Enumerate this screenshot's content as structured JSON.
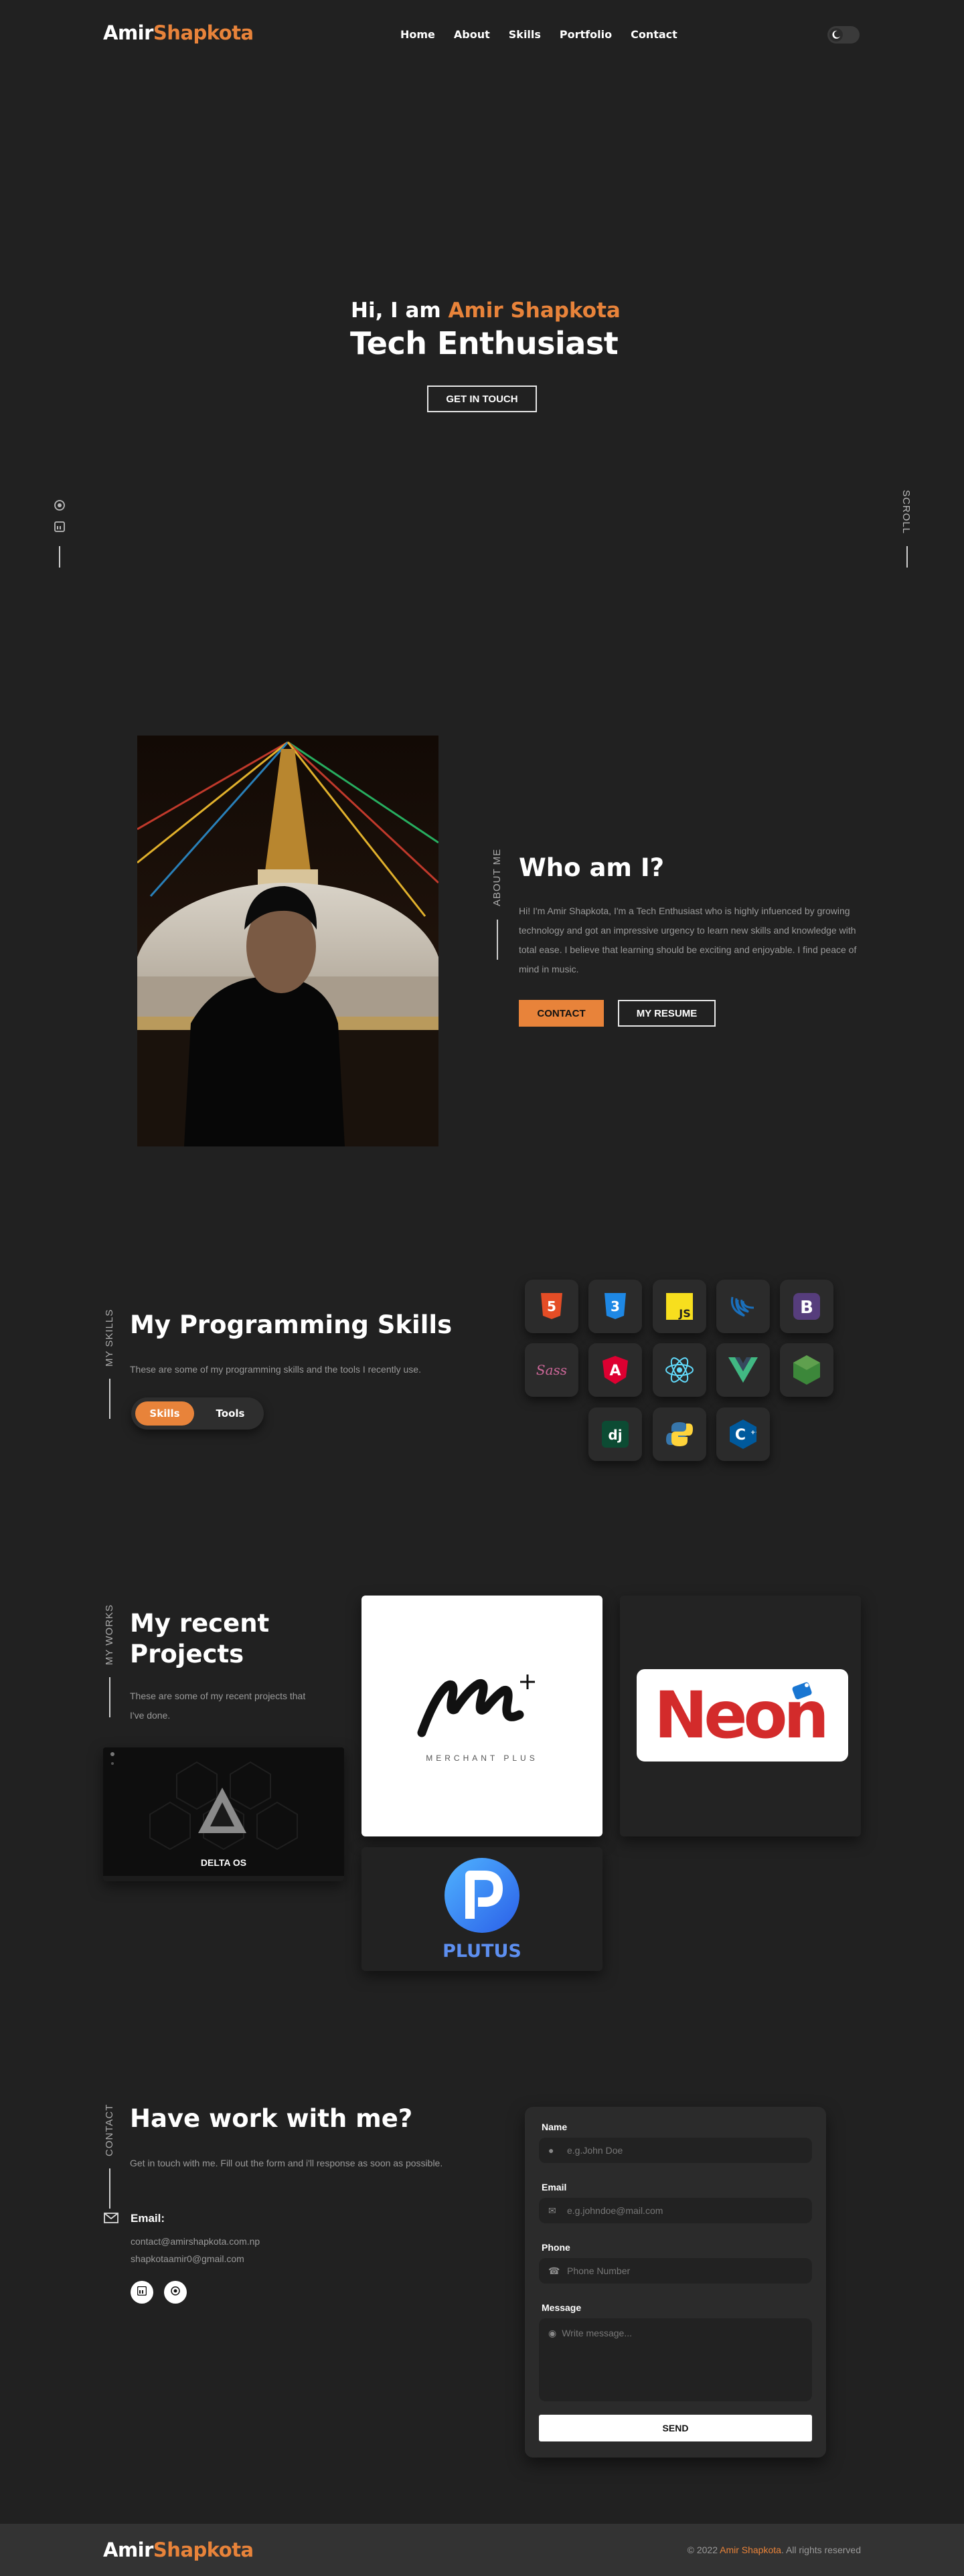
{
  "nav": {
    "logo_first": "Amir",
    "logo_second": "Shapkota",
    "links": [
      "Home",
      "About",
      "Skills",
      "Portfolio",
      "Contact"
    ],
    "theme_icon": "moon-icon"
  },
  "hero": {
    "greeting": "Hi, I am ",
    "name": "Amir Shapkota",
    "title": "Tech Enthusiast",
    "cta": "GET IN TOUCH",
    "scroll_label": "SCROLL",
    "social_icons": [
      "github-icon",
      "linkedin-icon"
    ]
  },
  "about": {
    "side_label": "ABOUT ME",
    "title": "Who am I?",
    "text": "Hi! I'm Amir Shapkota, I'm a Tech Enthusiast who is highly infuenced by growing technology and got an impressive urgency to learn new skills and knowledge with total ease. I believe that learning should be exciting and enjoyable. I find peace of mind in music.",
    "contact_btn": "CONTACT",
    "resume_btn": "MY RESUME"
  },
  "skills": {
    "side_label": "MY SKILLS",
    "title": "My Programming Skills",
    "text": "These are some of my programming skills and the tools I recently use.",
    "toggle_on": "Skills",
    "toggle_off": "Tools",
    "tiles": [
      {
        "icon": "html5-icon",
        "glyph": "5"
      },
      {
        "icon": "css3-icon",
        "glyph": "3"
      },
      {
        "icon": "javascript-icon",
        "glyph": "JS"
      },
      {
        "icon": "jquery-icon",
        "glyph": ""
      },
      {
        "icon": "bootstrap-icon",
        "glyph": "B"
      },
      {
        "icon": "sass-icon",
        "glyph": "Sass"
      },
      {
        "icon": "angular-icon",
        "glyph": "A"
      },
      {
        "icon": "react-icon",
        "glyph": ""
      },
      {
        "icon": "vue-icon",
        "glyph": ""
      },
      {
        "icon": "nodejs-icon",
        "glyph": ""
      },
      {
        "icon": "django-icon",
        "glyph": "dj"
      },
      {
        "icon": "python-icon",
        "glyph": ""
      },
      {
        "icon": "cplusplus-icon",
        "glyph": "C"
      }
    ]
  },
  "projects": {
    "side_label": "MY WORKS",
    "title_line1": "My recent",
    "title_line2": "Projects",
    "text": "These are some of my recent projects that I've done.",
    "delta": "DELTA OS",
    "merchant_sub": "MERCHANT PLUS",
    "neon": "Neon",
    "plutus": "PLUTUS"
  },
  "contact": {
    "side_label": "CONTACT",
    "title": "Have work with me?",
    "text": "Get in touch with me. Fill out the form and i'll response as soon as possible.",
    "email_label": "Email:",
    "email_1": "contact@amirshapkota.com.np",
    "email_2": "shapkotaamir0@gmail.com",
    "form": {
      "name_label": "Name",
      "name_placeholder": "e.g.John Doe",
      "email_label": "Email",
      "email_placeholder": "e.g.johndoe@mail.com",
      "phone_label": "Phone",
      "phone_placeholder": "Phone Number",
      "message_label": "Message",
      "message_placeholder": "Write message...",
      "send": "SEND"
    }
  },
  "footer": {
    "logo_first": "Amir",
    "logo_second": "Shapkota",
    "copy_prefix": "© 2022 ",
    "copy_name": "Amir Shapkota",
    "copy_suffix": ". All rights reserved"
  },
  "colors": {
    "accent": "#e8833a",
    "background": "#212121"
  }
}
